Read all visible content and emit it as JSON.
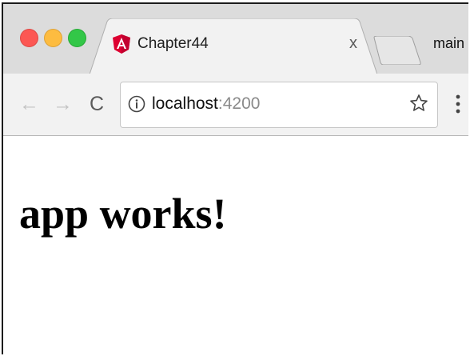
{
  "tab": {
    "title": "Chapter44",
    "close_label": "x",
    "icon": "angular-icon"
  },
  "profile": {
    "label": "main"
  },
  "toolbar": {
    "back_label": "←",
    "forward_label": "→",
    "reload_label": "C"
  },
  "address_bar": {
    "host": "localhost",
    "port": ":4200",
    "info_icon": "info-icon",
    "bookmark_icon": "star-icon"
  },
  "page": {
    "heading": "app works!"
  },
  "colors": {
    "close_red": "#fc5753",
    "minimize_yellow": "#fdbc40",
    "maximize_green": "#33c748",
    "angular_red": "#dd0031"
  }
}
